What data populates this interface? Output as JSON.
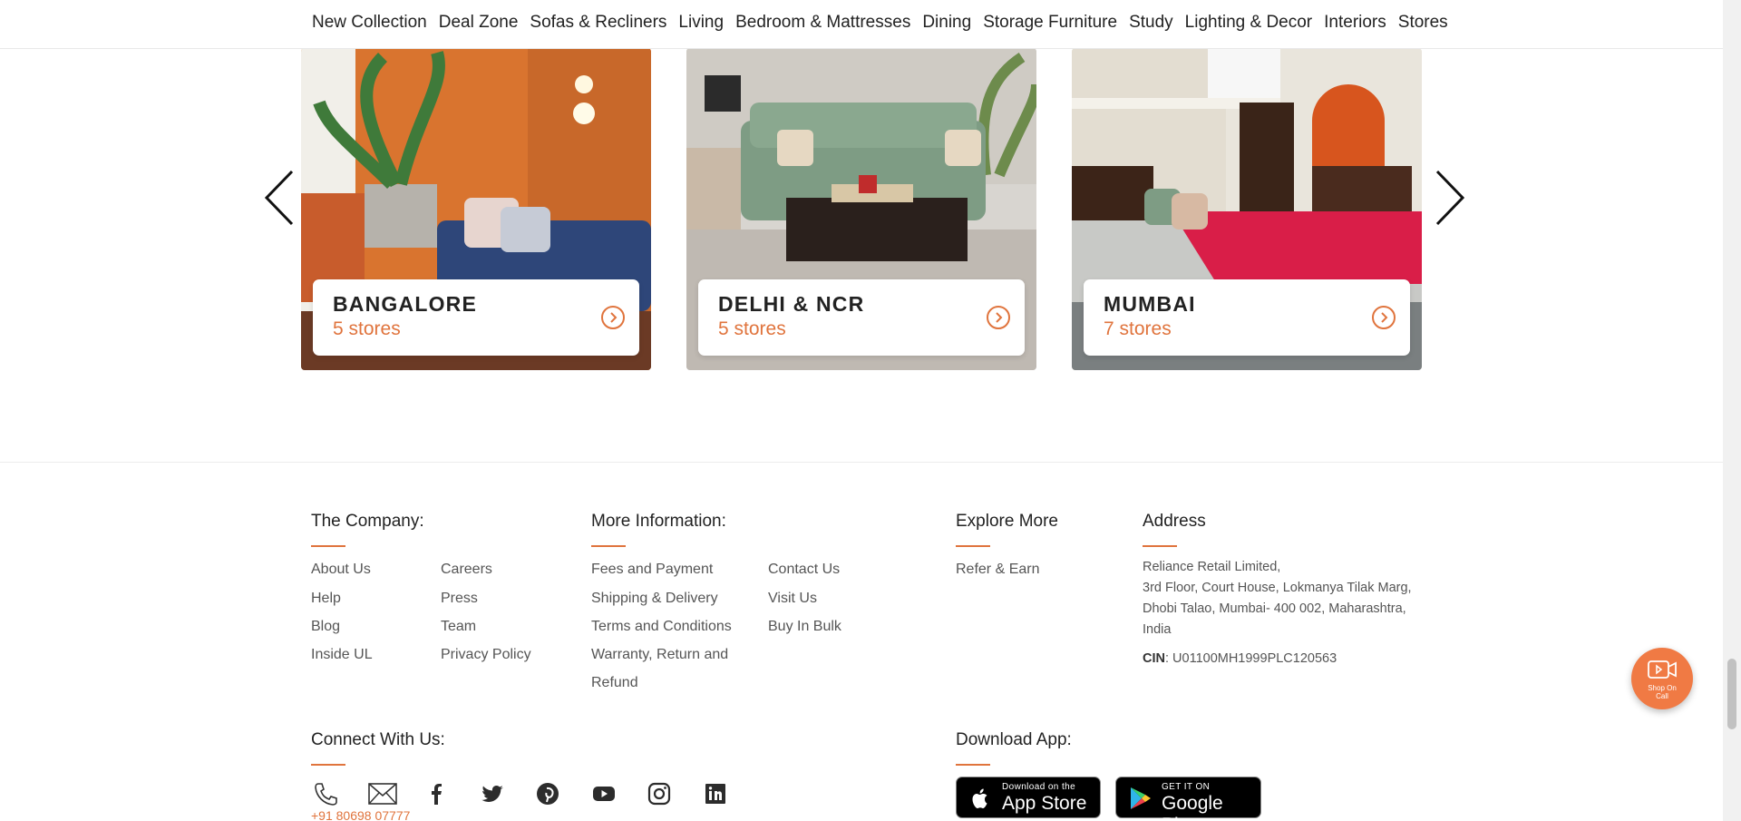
{
  "nav": [
    "New Collection",
    "Deal Zone",
    "Sofas & Recliners",
    "Living",
    "Bedroom & Mattresses",
    "Dining",
    "Storage Furniture",
    "Study",
    "Lighting & Decor",
    "Interiors",
    "Stores"
  ],
  "cities": [
    {
      "name": "BANGALORE",
      "count": "5 stores"
    },
    {
      "name": "DELHI & NCR",
      "count": "5 stores"
    },
    {
      "name": "MUMBAI",
      "count": "7 stores"
    }
  ],
  "footer": {
    "company": {
      "heading": "The Company:",
      "col1": [
        "About Us",
        "Help",
        "Blog",
        "Inside UL"
      ],
      "col2": [
        "Careers",
        "Press",
        "Team",
        "Privacy Policy"
      ]
    },
    "more_info": {
      "heading": "More Information:",
      "col1": [
        "Fees and Payment",
        "Shipping & Delivery",
        "Terms and Conditions",
        "Warranty, Return and",
        "Refund"
      ],
      "col2": [
        "Contact Us",
        "Visit Us",
        "Buy In Bulk"
      ]
    },
    "explore": {
      "heading": "Explore More",
      "links": [
        "Refer & Earn"
      ]
    },
    "address": {
      "heading": "Address",
      "lines": [
        "Reliance Retail Limited,",
        "3rd Floor, Court House, Lokmanya Tilak Marg,",
        "Dhobi Talao, Mumbai- 400 002, Maharashtra,",
        "India"
      ],
      "cin_label": "CIN",
      "cin_value": ": U01100MH1999PLC120563"
    },
    "connect": {
      "heading": "Connect With Us:",
      "phone": "+91 80698 07777",
      "icons": [
        "phone-icon",
        "mail-icon",
        "facebook-icon",
        "twitter-icon",
        "pinterest-icon",
        "youtube-icon",
        "instagram-icon",
        "linkedin-icon"
      ]
    },
    "download": {
      "heading": "Download App:",
      "appstore_small": "Download on the",
      "appstore_big": "App Store",
      "play_small": "GET IT ON",
      "play_big": "Google Play"
    }
  },
  "shop_call": {
    "label_1": "Shop On",
    "label_2": "Call"
  },
  "colors": {
    "accent": "#e0743d",
    "text": "#222222"
  }
}
